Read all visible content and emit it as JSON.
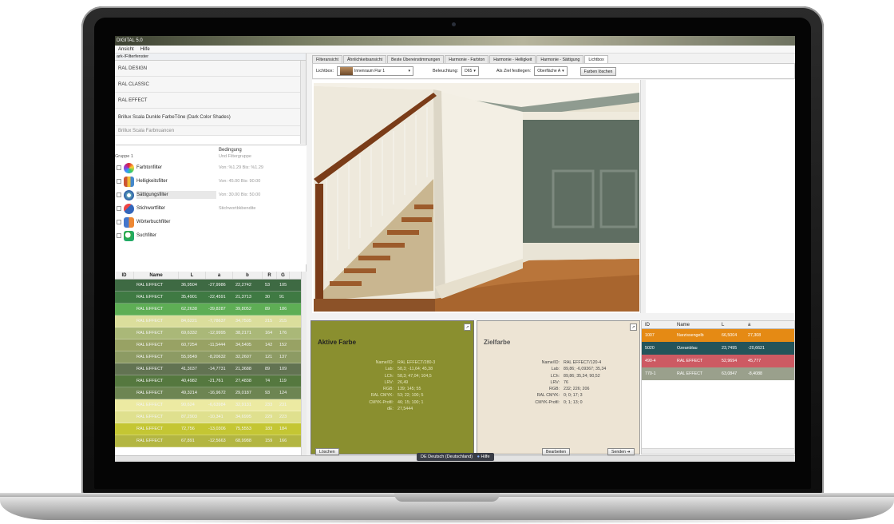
{
  "app": {
    "title": "DIGITAL 5.0"
  },
  "menu": [
    "Ansicht",
    "Hilfe"
  ],
  "left_pane": {
    "title": "ark-/Filterfenster",
    "collections": [
      "RAL DESIGN",
      "RAL CLASSIC",
      "RAL EFFECT",
      "Brillux Scala Dunkle FarbeTöne (Dark Color Shades)",
      "Brillux Scala Farbnuancen"
    ]
  },
  "filters": {
    "condition_header": "Bedingung",
    "group_label": "Gruppe 1",
    "group_sub": "Und Filtergruppe",
    "items": [
      {
        "name": "Farbtonfilter",
        "cond": "Von: %1.29 Bis: %1.29",
        "icon": "hue-wheel-icon",
        "color": "#c9503f"
      },
      {
        "name": "Helligkeitsfilter",
        "cond": "Von: 45.00 Bis: 90.00",
        "icon": "lightness-icon",
        "color": "#e3a23c"
      },
      {
        "name": "Sättigungsfilter",
        "cond": "Von: 30.00 Bis: 50.00",
        "icon": "saturation-icon",
        "color": "#4b8fd0"
      },
      {
        "name": "Stichwortfilter",
        "cond": "Stichwortbkbendite",
        "icon": "keyword-icon",
        "color": "#3b6fb4"
      },
      {
        "name": "Wörterbuchfilter",
        "cond": "",
        "icon": "dictionary-icon",
        "color": "#5a7fc8"
      },
      {
        "name": "Suchfilter",
        "cond": "",
        "icon": "search-filter-icon",
        "color": "#3aa04a"
      }
    ]
  },
  "left_table": {
    "headers": [
      "ID",
      "Name",
      "L",
      "a",
      "b",
      "R",
      "G"
    ],
    "rows": [
      {
        "name": "RAL EFFECT",
        "l": "36,9504",
        "a": "-27,9986",
        "b": "22,2742",
        "r": "53",
        "g": "105",
        "color": "#3e6a43"
      },
      {
        "name": "RAL EFFECT",
        "l": "35,4901",
        "a": "-22,4591",
        "b": "21,3713",
        "r": "30",
        "g": "91",
        "color": "#3f7a43"
      },
      {
        "name": "RAL EFFECT",
        "l": "62,2638",
        "a": "-39,8287",
        "b": "39,8052",
        "r": "89",
        "g": "186",
        "color": "#5eae55"
      },
      {
        "name": "RAL EFFECT",
        "l": "84,6221",
        "a": "-7,78637",
        "b": "34,7505",
        "r": "215",
        "g": "215",
        "color": "#dbde9c"
      },
      {
        "name": "RAL EFFECT",
        "l": "69,6332",
        "a": "-12,9995",
        "b": "38,2171",
        "r": "164",
        "g": "176",
        "color": "#aab878"
      },
      {
        "name": "RAL EFFECT",
        "l": "60,7254",
        "a": "-11,5444",
        "b": "34,5405",
        "r": "142",
        "g": "152",
        "color": "#98a264"
      },
      {
        "name": "RAL EFFECT",
        "l": "55,9549",
        "a": "-8,20632",
        "b": "32,2607",
        "r": "121",
        "g": "137",
        "color": "#8d9b64"
      },
      {
        "name": "RAL EFFECT",
        "l": "41,3037",
        "a": "-14,7731",
        "b": "21,3688",
        "r": "89",
        "g": "109",
        "color": "#627352"
      },
      {
        "name": "RAL EFFECT",
        "l": "40,4982",
        "a": "-21,761",
        "b": "27,4838",
        "r": "74",
        "g": "119",
        "color": "#55783f"
      },
      {
        "name": "RAL EFFECT",
        "l": "49,3214",
        "a": "-16,9672",
        "b": "29,0187",
        "r": "93",
        "g": "124",
        "color": "#6d8552"
      },
      {
        "name": "RAL EFFECT",
        "l": "90,624",
        "a": "-6,63984",
        "b": "32,9131",
        "r": "233",
        "g": "231",
        "color": "#eceaa2"
      },
      {
        "name": "RAL EFFECT",
        "l": "87,2903",
        "a": "-10,341",
        "b": "34,6995",
        "r": "229",
        "g": "223",
        "color": "#dfe08e"
      },
      {
        "name": "RAL EFFECT",
        "l": "72,756",
        "a": "-13,0306",
        "b": "75,5553",
        "r": "183",
        "g": "184",
        "color": "#c4c633"
      },
      {
        "name": "RAL EFFECT",
        "l": "67,891",
        "a": "-12,5663",
        "b": "68,9988",
        "r": "159",
        "g": "166",
        "color": "#b3b642"
      }
    ]
  },
  "tabs": [
    "Filteransicht",
    "Ähnlichkeitsansicht",
    "Beste Übereinstimmungen",
    "Harmonie - Farbton",
    "Harmonie - Helligkeit",
    "Harmonie - Sättigung",
    "Lichtbox"
  ],
  "toolbar": {
    "lightbox_label": "Lichtbox:",
    "lightbox_value": "Innenraum Flur 1",
    "illumination_label": "Beleuchtung:",
    "illumination_value": "D65",
    "target_label": "Als Ziel festlegen:",
    "target_value": "Oberfläche A",
    "button_label": "Farben löschen"
  },
  "active_color": {
    "title": "Aktive Farbe",
    "color": "#8a8f2f",
    "labels": [
      "Name/ID:",
      "Lab:",
      "LCh:",
      "LRV:",
      "RGB:",
      "RAL CMYK:",
      "CMYK-Profil:",
      "dE:"
    ],
    "values": [
      "RAL EFFECT/280-3",
      "58,3; -11,64; 45,38",
      "58,3; 47,04; 104,5",
      "26,49",
      "139; 145; 55",
      "53; 22; 100; 5",
      "46; 15; 100; 1",
      "27,5444"
    ]
  },
  "target_color": {
    "title": "Zielfarbe",
    "color": "#ede4d4",
    "labels": [
      "Name/ID:",
      "Lab:",
      "LCh:",
      "LRV:",
      "RGB:",
      "RAL CMYK:",
      "CMYK-Profil:"
    ],
    "values": [
      "RAL EFFECT/120-4",
      "89,86; -6,09367; 35,34",
      "89,86; 35,34; 90,52",
      "76",
      "232; 226; 206",
      "0; 0; 17; 3",
      "0; 1; 13; 0"
    ]
  },
  "bottom_buttons": {
    "delete": "Löschen",
    "edit": "Bearbeiten",
    "send": "Senden ➜"
  },
  "right_table": {
    "headers": [
      "ID",
      "Name",
      "L",
      "a"
    ],
    "rows": [
      {
        "id": "1007",
        "name": "Narzissengelb",
        "l": "66,5004",
        "a": "27,308",
        "color": "#e58a14"
      },
      {
        "id": "5020",
        "name": "Ozeanblau",
        "l": "23,7495",
        "a": "-20,6621",
        "color": "#24545a"
      },
      {
        "id": "490-4",
        "name": "RAL EFFECT",
        "l": "52,9694",
        "a": "45,777",
        "color": "#cd5a63"
      },
      {
        "id": "770-1",
        "name": "RAL EFFECT",
        "l": "63,0847",
        "a": "-8,4088",
        "color": "#9aa08c"
      }
    ]
  },
  "status": {
    "language": "DE Deutsch (Deutschland)",
    "help": "Hilfe"
  }
}
